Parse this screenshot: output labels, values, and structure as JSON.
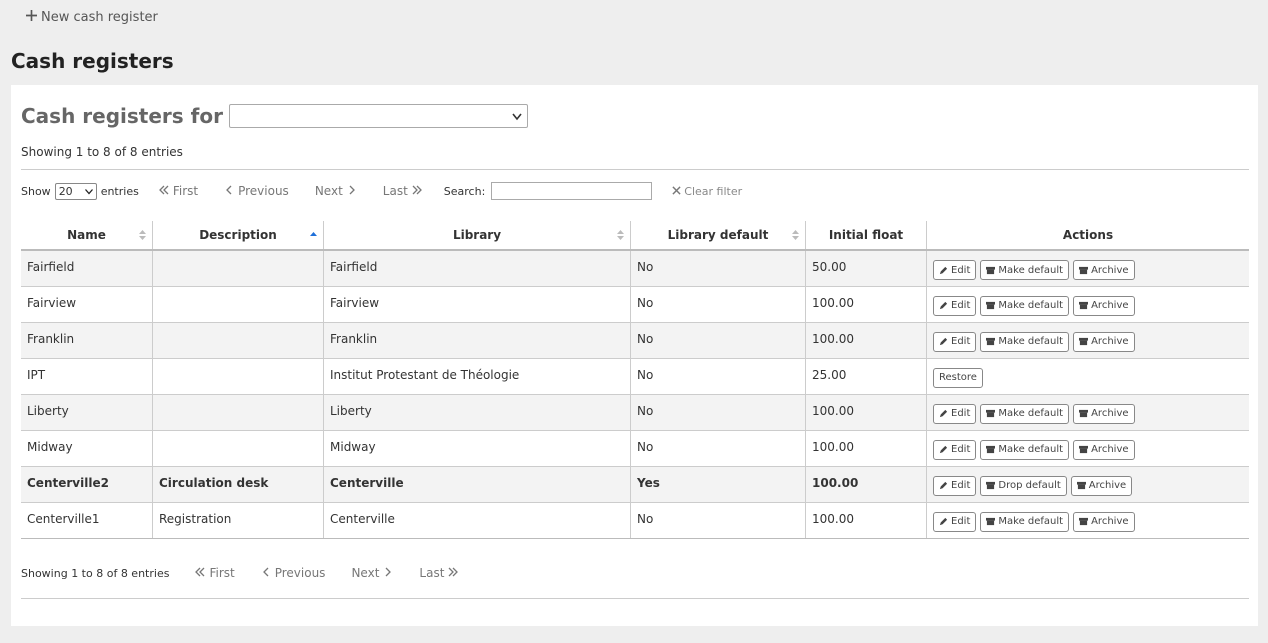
{
  "toolbar": {
    "new_label": "New cash register"
  },
  "page_title": "Cash registers",
  "filter": {
    "label": "Cash registers for",
    "selected": ""
  },
  "info": "Showing 1 to 8 of 8 entries",
  "info_bottom": "Showing 1 to 8 of 8 entries",
  "length": {
    "show": "Show",
    "value": "20",
    "entries": "entries"
  },
  "pager": {
    "first": "First",
    "previous": "Previous",
    "next": "Next",
    "last": "Last"
  },
  "search": {
    "label": "Search:",
    "value": ""
  },
  "clear_filter": "Clear filter",
  "columns": [
    "Name",
    "Description",
    "Library",
    "Library default",
    "Initial float",
    "Actions"
  ],
  "buttons": {
    "edit": "Edit",
    "make_default": "Make default",
    "drop_default": "Drop default",
    "archive": "Archive",
    "restore": "Restore"
  },
  "rows": [
    {
      "name": "Fairfield",
      "description": "",
      "library": "Fairfield",
      "library_default": "No",
      "initial_float": "50.00"
    },
    {
      "name": "Fairview",
      "description": "",
      "library": "Fairview",
      "library_default": "No",
      "initial_float": "100.00"
    },
    {
      "name": "Franklin",
      "description": "",
      "library": "Franklin",
      "library_default": "No",
      "initial_float": "100.00"
    },
    {
      "name": "IPT",
      "description": "",
      "library": "Institut Protestant de Théologie",
      "library_default": "No",
      "initial_float": "25.00"
    },
    {
      "name": "Liberty",
      "description": "",
      "library": "Liberty",
      "library_default": "No",
      "initial_float": "100.00"
    },
    {
      "name": "Midway",
      "description": "",
      "library": "Midway",
      "library_default": "No",
      "initial_float": "100.00"
    },
    {
      "name": "Centerville2",
      "description": "Circulation desk",
      "library": "Centerville",
      "library_default": "Yes",
      "initial_float": "100.00"
    },
    {
      "name": "Centerville1",
      "description": "Registration",
      "library": "Centerville",
      "library_default": "No",
      "initial_float": "100.00"
    }
  ],
  "colors": {
    "sort_active": "#1e6fd9",
    "row_alt": "#f3f3f3",
    "panel_bg": "#ffffff",
    "page_bg": "#eeeeee"
  }
}
